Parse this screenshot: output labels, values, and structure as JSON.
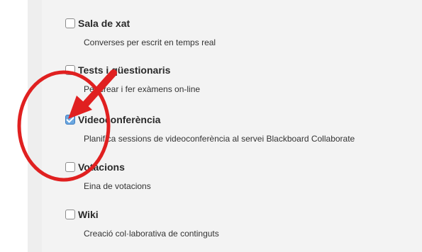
{
  "tools": [
    {
      "title": "Sala de xat",
      "description": "Converses per escrit en temps real",
      "checked": false
    },
    {
      "title": "Tests i qüestionaris",
      "description": "Per crear i fer exàmens on-line",
      "checked": false
    },
    {
      "title": "Videoconferència",
      "description": "Planifica sessions de videoconferència al servei Blackboard Collaborate",
      "checked": true
    },
    {
      "title": "Votacions",
      "description": "Eina de votacions",
      "checked": false
    },
    {
      "title": "Wiki",
      "description": "Creació col·laborativa de continguts",
      "checked": false
    }
  ],
  "annotation": {
    "color": "#e02020"
  }
}
